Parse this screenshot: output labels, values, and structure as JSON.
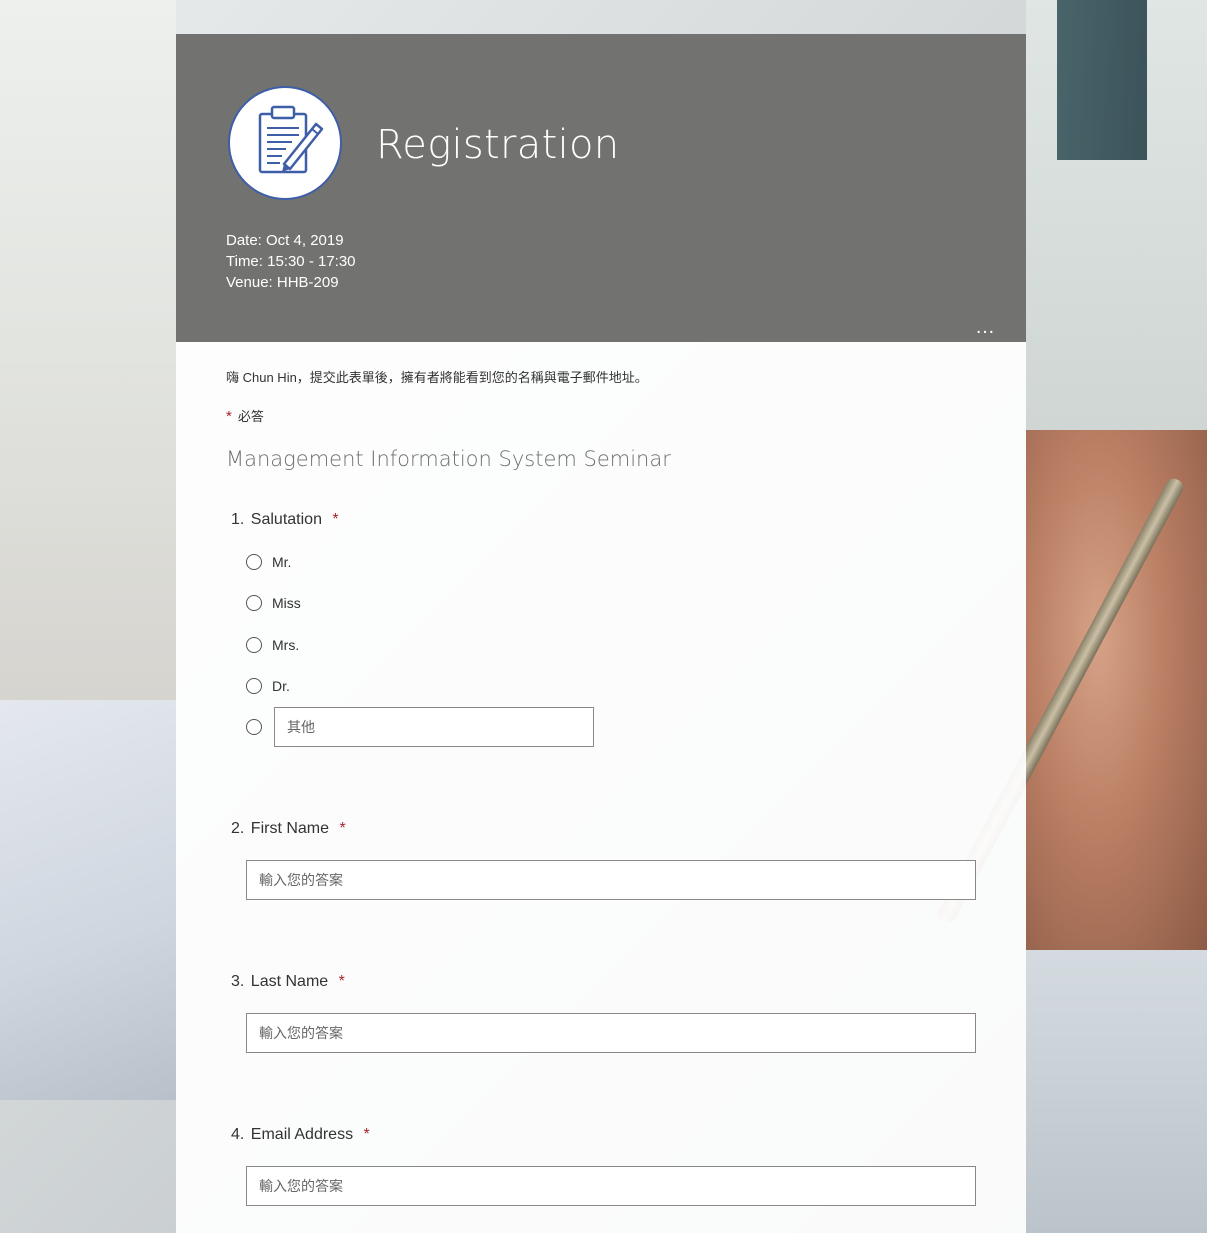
{
  "header": {
    "title": "Registration",
    "date": "Date: Oct 4, 2019",
    "time": "Time: 15:30 - 17:30",
    "venue": "Venue: HHB-209",
    "more_icon": "…"
  },
  "notice": "嗨 Chun Hin，提交此表單後，擁有者將能看到您的名稱與電子郵件地址。",
  "required_note": {
    "star": "*",
    "label": "必答"
  },
  "form_subtitle": "Management Information System Seminar",
  "questions": {
    "q1": {
      "number": "1.",
      "label": "Salutation",
      "star": "*",
      "options": [
        "Mr.",
        "Miss",
        "Mrs.",
        "Dr."
      ],
      "other_placeholder": "其他"
    },
    "q2": {
      "number": "2.",
      "label": "First Name",
      "star": "*",
      "placeholder": "輸入您的答案"
    },
    "q3": {
      "number": "3.",
      "label": "Last Name",
      "star": "*",
      "placeholder": "輸入您的答案"
    },
    "q4": {
      "number": "4.",
      "label": "Email Address",
      "star": "*",
      "placeholder": "輸入您的答案"
    }
  },
  "colors": {
    "header_bg": "#727371",
    "required_star": "#a4262c",
    "logo_stroke": "#3f5ea8"
  },
  "icons": {
    "logo": "clipboard-pen-icon",
    "more": "more-options-icon"
  }
}
